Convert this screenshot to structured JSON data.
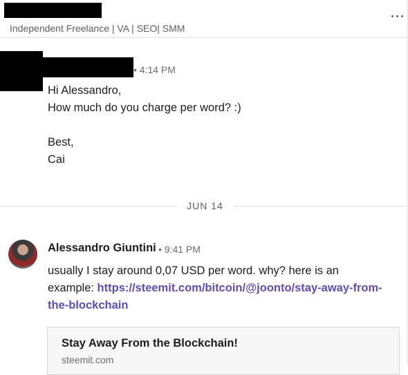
{
  "header": {
    "subtitle": "Independent Freelance | VA | SEO| SMM",
    "more_icon": "ellipsis-horizontal-icon"
  },
  "messages": [
    {
      "sender": "",
      "time": "• 4:14 PM",
      "lines": [
        "Hi Alessandro,",
        "How much do you charge per word? :)",
        "",
        "Best,",
        "Cai"
      ]
    },
    {
      "sender": "Alessandro Giuntini",
      "time": "• 9:41 PM",
      "line1": "usually I stay around 0,07 USD per word. why? here is an",
      "line2_prefix": "example: ",
      "link_part1": "https://steemit.com/bitcoin/@joonto/stay-away-from-",
      "link_part2": "the-blockchain"
    }
  ],
  "date_divider": "JUN 14",
  "preview": {
    "title": "Stay Away From the Blockchain!",
    "domain": "steemit.com"
  },
  "colors": {
    "link": "#5b4fb6",
    "divider": "#e1e1e1"
  }
}
